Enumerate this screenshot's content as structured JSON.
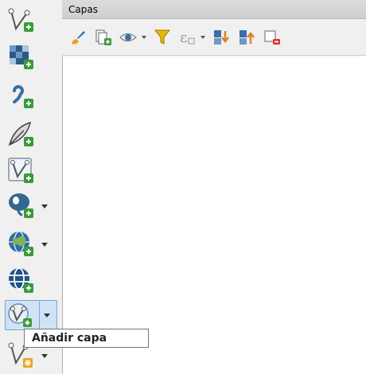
{
  "panel": {
    "title": "Capas"
  },
  "tooltip": {
    "text": "Añadir capa"
  },
  "left_toolbar": {
    "tools": [
      {
        "icon": "vector-layer-add-icon"
      },
      {
        "icon": "raster-layer-add-icon"
      },
      {
        "icon": "delimited-text-add-icon"
      },
      {
        "icon": "spatialite-layer-add-icon"
      },
      {
        "icon": "virtual-layer-add-icon"
      },
      {
        "icon": "postgis-layer-add-icon"
      },
      {
        "icon": "wms-layer-add-icon"
      },
      {
        "icon": "wcs-layer-add-icon"
      },
      {
        "icon": "add-layer-icon"
      },
      {
        "icon": "new-shapefile-layer-icon"
      }
    ]
  },
  "panel_toolbar": {
    "tools": [
      {
        "icon": "style-paintbrush-icon"
      },
      {
        "icon": "add-group-icon"
      },
      {
        "icon": "visibility-eye-icon"
      },
      {
        "icon": "filter-legend-icon"
      },
      {
        "icon": "filter-expression-icon"
      },
      {
        "icon": "expand-all-icon"
      },
      {
        "icon": "collapse-all-icon"
      },
      {
        "icon": "remove-layer-icon"
      }
    ]
  },
  "colors": {
    "add_badge": "#3a9a3a",
    "active_highlight": "#cfe3f5",
    "filter_yellow": "#e6b800"
  }
}
